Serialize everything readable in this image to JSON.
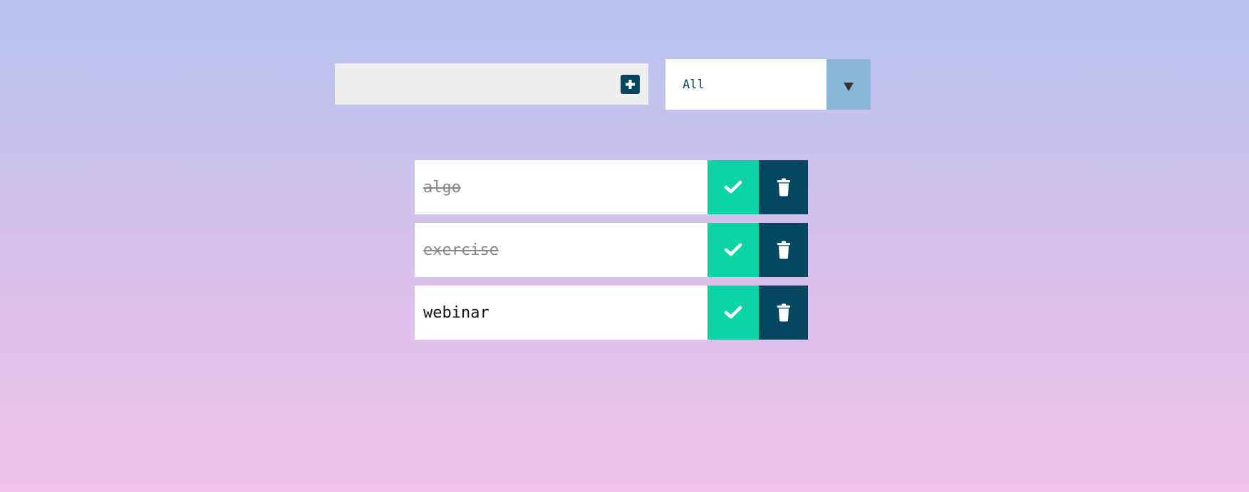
{
  "form": {
    "input_value": "",
    "input_placeholder": "",
    "add_icon": "plus-square-icon",
    "filter": {
      "selected": "All",
      "arrow_icon": "caret-down-icon"
    }
  },
  "todos": [
    {
      "text": "algo",
      "completed": true
    },
    {
      "text": "exercise",
      "completed": true
    },
    {
      "text": "webinar",
      "completed": false
    }
  ],
  "colors": {
    "complete": "#0cd4a5",
    "trash": "#054660",
    "select_arrow": "#8ab7d8",
    "input_bg": "#eeeeee",
    "completed_text": "#888888"
  },
  "icons": {
    "complete": "check-icon",
    "delete": "trash-icon"
  }
}
